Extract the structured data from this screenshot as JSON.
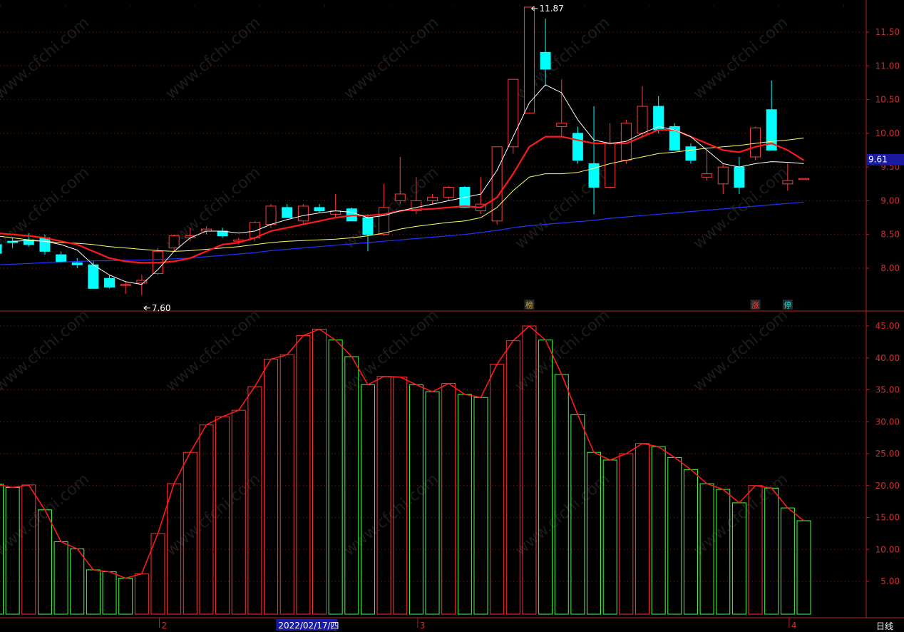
{
  "chart_data": [
    {
      "type": "candlestick",
      "ylim": [
        7.5,
        11.9
      ],
      "yticks": [
        "8.00",
        "8.50",
        "9.00",
        "9.50",
        "10.00",
        "10.50",
        "11.00",
        "11.50"
      ],
      "last_price": "9.61",
      "ohlc": [
        [
          8.35,
          8.45,
          8.15,
          8.22
        ],
        [
          8.4,
          8.45,
          8.3,
          8.38
        ],
        [
          8.42,
          8.52,
          8.32,
          8.35
        ],
        [
          8.45,
          8.5,
          8.2,
          8.25
        ],
        [
          8.2,
          8.25,
          8.08,
          8.1
        ],
        [
          8.08,
          8.15,
          8.0,
          8.05
        ],
        [
          8.05,
          8.1,
          7.7,
          7.7
        ],
        [
          7.85,
          7.9,
          7.7,
          7.72
        ],
        [
          7.75,
          7.8,
          7.62,
          7.76
        ],
        [
          7.78,
          7.9,
          7.6,
          7.82
        ],
        [
          7.92,
          8.3,
          7.9,
          8.25
        ],
        [
          8.3,
          8.5,
          8.25,
          8.48
        ],
        [
          8.45,
          8.6,
          8.4,
          8.48
        ],
        [
          8.55,
          8.62,
          8.5,
          8.58
        ],
        [
          8.55,
          8.6,
          8.45,
          8.48
        ],
        [
          8.4,
          8.45,
          8.35,
          8.42
        ],
        [
          8.45,
          8.7,
          8.4,
          8.68
        ],
        [
          8.65,
          8.95,
          8.6,
          8.92
        ],
        [
          8.9,
          8.95,
          8.75,
          8.75
        ],
        [
          8.7,
          8.95,
          8.65,
          8.92
        ],
        [
          8.9,
          8.95,
          8.82,
          8.85
        ],
        [
          8.8,
          9.1,
          8.75,
          8.85
        ],
        [
          8.88,
          8.9,
          8.7,
          8.7
        ],
        [
          8.75,
          8.8,
          8.25,
          8.5
        ],
        [
          8.5,
          9.25,
          8.48,
          8.9
        ],
        [
          9.0,
          9.65,
          8.95,
          9.1
        ],
        [
          8.85,
          9.35,
          8.8,
          9.0
        ],
        [
          9.0,
          9.1,
          8.95,
          9.05
        ],
        [
          9.05,
          9.22,
          9.0,
          9.2
        ],
        [
          9.2,
          9.22,
          8.9,
          8.9
        ],
        [
          8.85,
          9.35,
          8.8,
          8.95
        ],
        [
          8.7,
          9.8,
          8.65,
          9.8
        ],
        [
          9.8,
          10.7,
          9.7,
          10.8
        ],
        [
          10.3,
          11.87,
          10.3,
          11.87
        ],
        [
          11.2,
          11.7,
          10.7,
          10.95
        ],
        [
          10.1,
          10.8,
          9.95,
          10.15
        ],
        [
          10.0,
          10.1,
          9.55,
          9.6
        ],
        [
          9.55,
          10.4,
          8.8,
          9.2
        ],
        [
          9.2,
          10.15,
          9.2,
          9.85
        ],
        [
          9.6,
          10.2,
          9.55,
          10.15
        ],
        [
          10.0,
          10.7,
          9.95,
          10.4
        ],
        [
          10.4,
          10.55,
          10.0,
          10.05
        ],
        [
          10.1,
          10.15,
          9.75,
          9.75
        ],
        [
          9.8,
          9.85,
          9.55,
          9.6
        ],
        [
          9.35,
          9.75,
          9.3,
          9.4
        ],
        [
          9.25,
          9.55,
          9.1,
          9.5
        ],
        [
          9.5,
          9.65,
          9.1,
          9.2
        ],
        [
          9.65,
          10.1,
          9.6,
          10.08
        ],
        [
          10.35,
          10.78,
          9.75,
          9.75
        ],
        [
          9.25,
          9.55,
          9.15,
          9.3
        ],
        [
          9.33,
          9.33,
          9.33,
          9.33
        ]
      ],
      "ma_short": [
        null,
        8.4,
        8.41,
        8.4,
        8.35,
        8.27,
        8.05,
        7.9,
        7.8,
        7.76,
        7.98,
        8.25,
        8.45,
        8.55,
        8.55,
        8.52,
        8.55,
        8.65,
        8.72,
        8.78,
        8.82,
        8.85,
        8.83,
        8.75,
        8.78,
        8.85,
        8.9,
        8.95,
        9.0,
        9.05,
        9.1,
        9.45,
        9.95,
        10.45,
        10.72,
        10.6,
        10.2,
        9.9,
        9.85,
        9.88,
        10.0,
        10.1,
        10.05,
        9.95,
        9.75,
        9.55,
        9.5,
        9.55,
        9.58,
        9.57,
        9.55
      ],
      "ma_mid": [
        8.52,
        8.5,
        8.48,
        8.45,
        8.4,
        8.35,
        8.25,
        8.15,
        8.1,
        8.08,
        8.08,
        8.1,
        8.15,
        8.25,
        8.35,
        8.38,
        8.45,
        8.55,
        8.6,
        8.65,
        8.7,
        8.75,
        8.78,
        8.78,
        8.8,
        8.85,
        8.87,
        8.88,
        8.9,
        8.92,
        8.9,
        9.05,
        9.4,
        9.8,
        9.95,
        9.95,
        9.9,
        9.85,
        9.85,
        9.85,
        9.95,
        10.05,
        10.05,
        9.95,
        9.85,
        9.75,
        9.72,
        9.8,
        9.85,
        9.75,
        9.6
      ],
      "ma_long": [
        8.48,
        8.45,
        8.42,
        8.4,
        8.38,
        8.37,
        8.35,
        8.32,
        8.3,
        8.28,
        8.26,
        8.25,
        8.26,
        8.28,
        8.3,
        8.32,
        8.35,
        8.38,
        8.4,
        8.41,
        8.42,
        8.43,
        8.45,
        8.48,
        8.52,
        8.58,
        8.62,
        8.65,
        8.68,
        8.7,
        8.75,
        8.9,
        9.15,
        9.35,
        9.4,
        9.4,
        9.42,
        9.48,
        9.55,
        9.6,
        9.65,
        9.7,
        9.72,
        9.75,
        9.78,
        9.8,
        9.82,
        9.85,
        9.88,
        9.9,
        9.93
      ],
      "ma_slow": [
        8.05,
        8.06,
        8.07,
        8.08,
        8.09,
        8.1,
        8.11,
        8.11,
        8.12,
        8.12,
        8.13,
        8.14,
        8.15,
        8.17,
        8.19,
        8.21,
        8.23,
        8.26,
        8.28,
        8.3,
        8.32,
        8.34,
        8.36,
        8.38,
        8.4,
        8.42,
        8.44,
        8.46,
        8.48,
        8.5,
        8.53,
        8.56,
        8.6,
        8.63,
        8.65,
        8.67,
        8.69,
        8.71,
        8.74,
        8.76,
        8.78,
        8.8,
        8.82,
        8.84,
        8.86,
        8.88,
        8.9,
        8.92,
        8.94,
        8.96,
        8.98
      ],
      "annotations": [
        {
          "index": 33,
          "price": 11.87,
          "label": "11.87"
        },
        {
          "index": 9,
          "price": 7.6,
          "label": "7.60"
        }
      ],
      "badges": [
        {
          "index": 33,
          "label": "榜",
          "color": "#d4a017"
        },
        {
          "index": 47,
          "label": "涨",
          "color": "#ff4040"
        },
        {
          "index": 49,
          "label": "停",
          "color": "#00e5e5"
        }
      ]
    },
    {
      "type": "bar",
      "ylim": [
        0,
        46
      ],
      "yticks": [
        "5.00",
        "10.00",
        "15.00",
        "20.00",
        "25.00",
        "30.00",
        "35.00",
        "40.00",
        "45.00"
      ],
      "values": [
        20.2,
        19.7,
        20.1,
        16.2,
        11.2,
        10.1,
        6.8,
        6.5,
        5.5,
        6.2,
        12.5,
        20.3,
        25.2,
        29.5,
        30.8,
        31.8,
        35.5,
        39.8,
        40.5,
        43.5,
        44.5,
        42.8,
        40.2,
        35.8,
        37.1,
        37.0,
        35.8,
        34.7,
        36.0,
        34.3,
        33.8,
        39.0,
        42.7,
        45.0,
        42.8,
        37.4,
        31.1,
        25.2,
        24.0,
        25.0,
        26.6,
        26.1,
        24.4,
        22.5,
        20.3,
        19.4,
        17.3,
        20.0,
        19.6,
        16.5,
        14.5
      ],
      "colors": [
        "g",
        "g",
        "r",
        "g",
        "g",
        "g",
        "g",
        "g",
        "g",
        "r",
        "r",
        "r",
        "r",
        "r",
        "r",
        "r",
        "r",
        "r",
        "r",
        "r",
        "r",
        "g",
        "g",
        "g",
        "r",
        "r",
        "g",
        "g",
        "r",
        "g",
        "g",
        "r",
        "r",
        "r",
        "g",
        "g",
        "g",
        "g",
        "g",
        "r",
        "r",
        "g",
        "g",
        "g",
        "g",
        "g",
        "g",
        "r",
        "g",
        "g",
        "g"
      ]
    }
  ],
  "xaxis": {
    "labels": [
      {
        "index": 10,
        "text": "2"
      },
      {
        "index": 26,
        "text": "3"
      },
      {
        "index": 49,
        "text": "4"
      }
    ],
    "selected_date": "2022/02/17/四",
    "selected_index": 19,
    "period": "日线"
  },
  "watermark": "www.cfchi.com",
  "colors": {
    "up": "#ff3c3c",
    "down": "#00ffff",
    "vol_up": "#ff3030",
    "vol_down": "#40ff40",
    "ma_short": "#ffffff",
    "ma_mid": "#ff1a1a",
    "ma_long": "#ffff66",
    "ma_slow": "#2233ff",
    "grid": "#8b1a1a",
    "axis_text": "#c83232"
  }
}
